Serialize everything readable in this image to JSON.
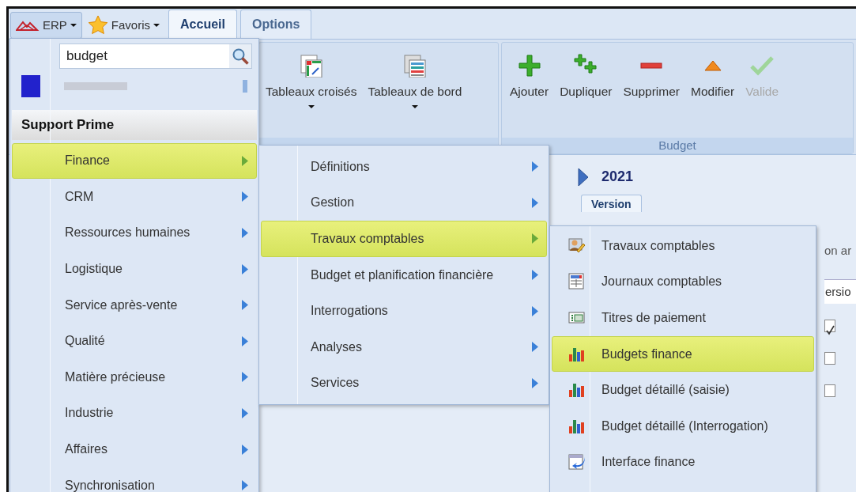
{
  "app_button": {
    "label": "ERP"
  },
  "favorites_button": {
    "label": "Favoris"
  },
  "tabs": [
    {
      "label": "Accueil",
      "selected": true
    },
    {
      "label": "Options",
      "selected": false
    }
  ],
  "ribbon": {
    "groups": [
      {
        "buttons": [
          {
            "label": "Tableaux croisés",
            "kind": "pivot",
            "dropdown": true,
            "disabled": false
          },
          {
            "label": "Tableaux de bord",
            "kind": "dashboard",
            "dropdown": true,
            "disabled": false
          }
        ]
      },
      {
        "label": "Budget",
        "buttons": [
          {
            "label": "Ajouter",
            "kind": "add",
            "dropdown": false,
            "disabled": false
          },
          {
            "label": "Dupliquer",
            "kind": "duplicate",
            "dropdown": false,
            "disabled": false
          },
          {
            "label": "Supprimer",
            "kind": "delete",
            "dropdown": false,
            "disabled": false
          },
          {
            "label": "Modifier",
            "kind": "edit",
            "dropdown": false,
            "disabled": false
          },
          {
            "label": "Valide",
            "kind": "validate",
            "dropdown": false,
            "disabled": true
          }
        ]
      }
    ]
  },
  "content": {
    "year": "2021",
    "tabs": [
      {
        "label": "Version",
        "selected": true
      }
    ],
    "label_fragment": "on ar",
    "field_value": "ersio",
    "checkboxes": [
      {
        "checked": true
      },
      {
        "checked": false
      },
      {
        "checked": false
      }
    ]
  },
  "main_menu": {
    "search": {
      "value": "budget"
    },
    "section": "Support Prime",
    "items": [
      {
        "label": "Finance",
        "selected": true
      },
      {
        "label": "CRM",
        "selected": false
      },
      {
        "label": "Ressources humaines",
        "selected": false
      },
      {
        "label": "Logistique",
        "selected": false
      },
      {
        "label": "Service après-vente",
        "selected": false
      },
      {
        "label": "Qualité",
        "selected": false
      },
      {
        "label": "Matière précieuse",
        "selected": false
      },
      {
        "label": "Industrie",
        "selected": false
      },
      {
        "label": "Affaires",
        "selected": false
      },
      {
        "label": "Synchronisation",
        "selected": false
      }
    ]
  },
  "submenu": {
    "items": [
      {
        "label": "Définitions",
        "selected": false
      },
      {
        "label": "Gestion",
        "selected": false
      },
      {
        "label": "Travaux comptables",
        "selected": true
      },
      {
        "label": "Budget et planification financière",
        "selected": false
      },
      {
        "label": "Interrogations",
        "selected": false
      },
      {
        "label": "Analyses",
        "selected": false
      },
      {
        "label": "Services",
        "selected": false
      }
    ]
  },
  "submenu_2": {
    "items": [
      {
        "label": "Travaux comptables",
        "kind": "worker",
        "selected": false
      },
      {
        "label": "Journaux comptables",
        "kind": "table",
        "selected": false
      },
      {
        "label": "Titres de paiement",
        "kind": "card",
        "selected": false
      },
      {
        "label": "Budgets finance",
        "kind": "chart",
        "selected": true
      },
      {
        "label": "Budget détaillé (saisie)",
        "kind": "chart",
        "selected": false
      },
      {
        "label": "Budget détaillé (Interrogation)",
        "kind": "chart",
        "selected": false
      },
      {
        "label": "Interface finance",
        "kind": "import",
        "selected": false
      }
    ]
  }
}
